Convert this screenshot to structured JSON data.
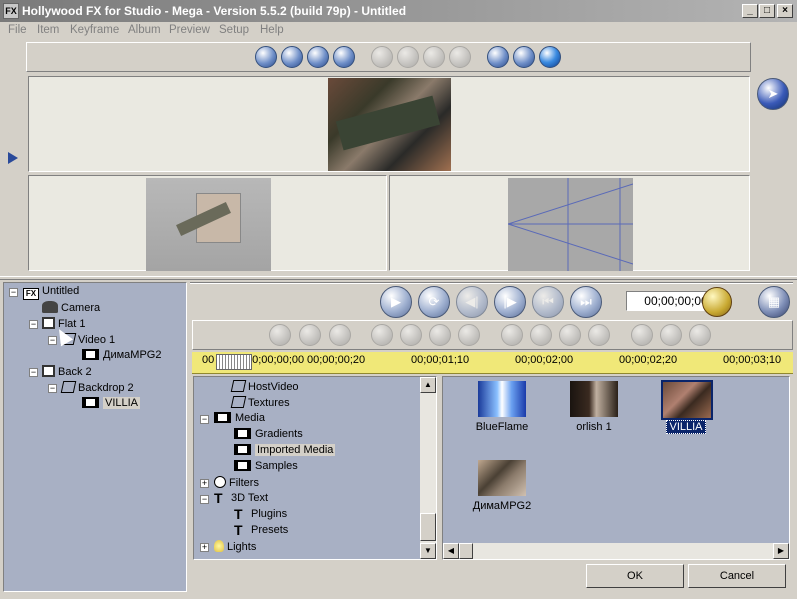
{
  "window": {
    "title": "Hollywood FX for Studio - Mega - Version 5.5.2 (build 79p)  - Untitled",
    "app_icon": "FX",
    "min_label": "_",
    "max_label": "□",
    "close_label": "×"
  },
  "menu": [
    "File",
    "Item",
    "Keyframe",
    "Album",
    "Preview",
    "Setup",
    "Help"
  ],
  "icons": {
    "view_toolbar": [
      "single-view-icon",
      "two-view-icon",
      "three-view-icon",
      "four-view-icon",
      "zoom-out-icon",
      "zoom-circle-icon",
      "zoom-in-icon",
      "zoom-fit-icon",
      "camera-icon",
      "light-icon",
      "globe-icon"
    ],
    "edit_toolbar": [
      "copy-icon",
      "paste-icon",
      "find-icon",
      "new-icon",
      "delete-icon",
      "duplicate-icon",
      "group-icon",
      "keyframe-add-icon",
      "keyframe-remove-icon",
      "keyframe-prev-icon",
      "keyframe-next-icon",
      "save-icon",
      "load-icon",
      "settings-icon"
    ]
  },
  "transport": {
    "timecode": "00;00;00;00"
  },
  "timeline": {
    "marks": [
      "00;00;00;00",
      "00;00;00;20",
      "00;00;01;10",
      "00;00;02;00",
      "00;00;02;20",
      "00;00;03;10"
    ],
    "visible_start": "00"
  },
  "scene_tree": [
    {
      "label": "Untitled",
      "icon": "fx-icon",
      "expander": "−"
    },
    {
      "label": "Camera",
      "icon": "camera-icon"
    },
    {
      "label": "Flat 1",
      "icon": "cube-icon",
      "expander": "−"
    },
    {
      "label": "Video 1",
      "icon": "flat-icon",
      "expander": "−"
    },
    {
      "label": "ДимаMPG2",
      "icon": "film-icon"
    },
    {
      "label": "Back 2",
      "icon": "cube-icon",
      "expander": "−"
    },
    {
      "label": "Backdrop 2",
      "icon": "flat-icon",
      "expander": "−"
    },
    {
      "label": "VILLIA",
      "icon": "film-icon"
    }
  ],
  "album_tree": [
    {
      "label": "HostVideo",
      "icon": "flat-icon"
    },
    {
      "label": "Textures",
      "icon": "flat-icon"
    },
    {
      "label": "Media",
      "icon": "film-icon",
      "expander": "−"
    },
    {
      "label": "Gradients",
      "icon": "film-icon"
    },
    {
      "label": "Imported Media",
      "icon": "film-icon",
      "selected": true
    },
    {
      "label": "Samples",
      "icon": "film-icon"
    },
    {
      "label": "Filters",
      "icon": "filter-icon",
      "expander": "+"
    },
    {
      "label": "3D Text",
      "icon": "text-icon",
      "expander": "−"
    },
    {
      "label": "Plugins",
      "icon": "text-icon"
    },
    {
      "label": "Presets",
      "icon": "text-icon"
    },
    {
      "label": "Lights",
      "icon": "bulb-icon",
      "expander": "+"
    }
  ],
  "media_items": [
    {
      "label": "BlueFlame"
    },
    {
      "label": "orlish 1"
    },
    {
      "label": "VILLIA",
      "selected": true
    },
    {
      "label": "ДимаMPG2"
    }
  ],
  "buttons": {
    "ok": "OK",
    "cancel": "Cancel"
  },
  "colors": {
    "ruler": "#f0e878",
    "selection": "#0a246a",
    "panel": "#a8b0c4"
  }
}
